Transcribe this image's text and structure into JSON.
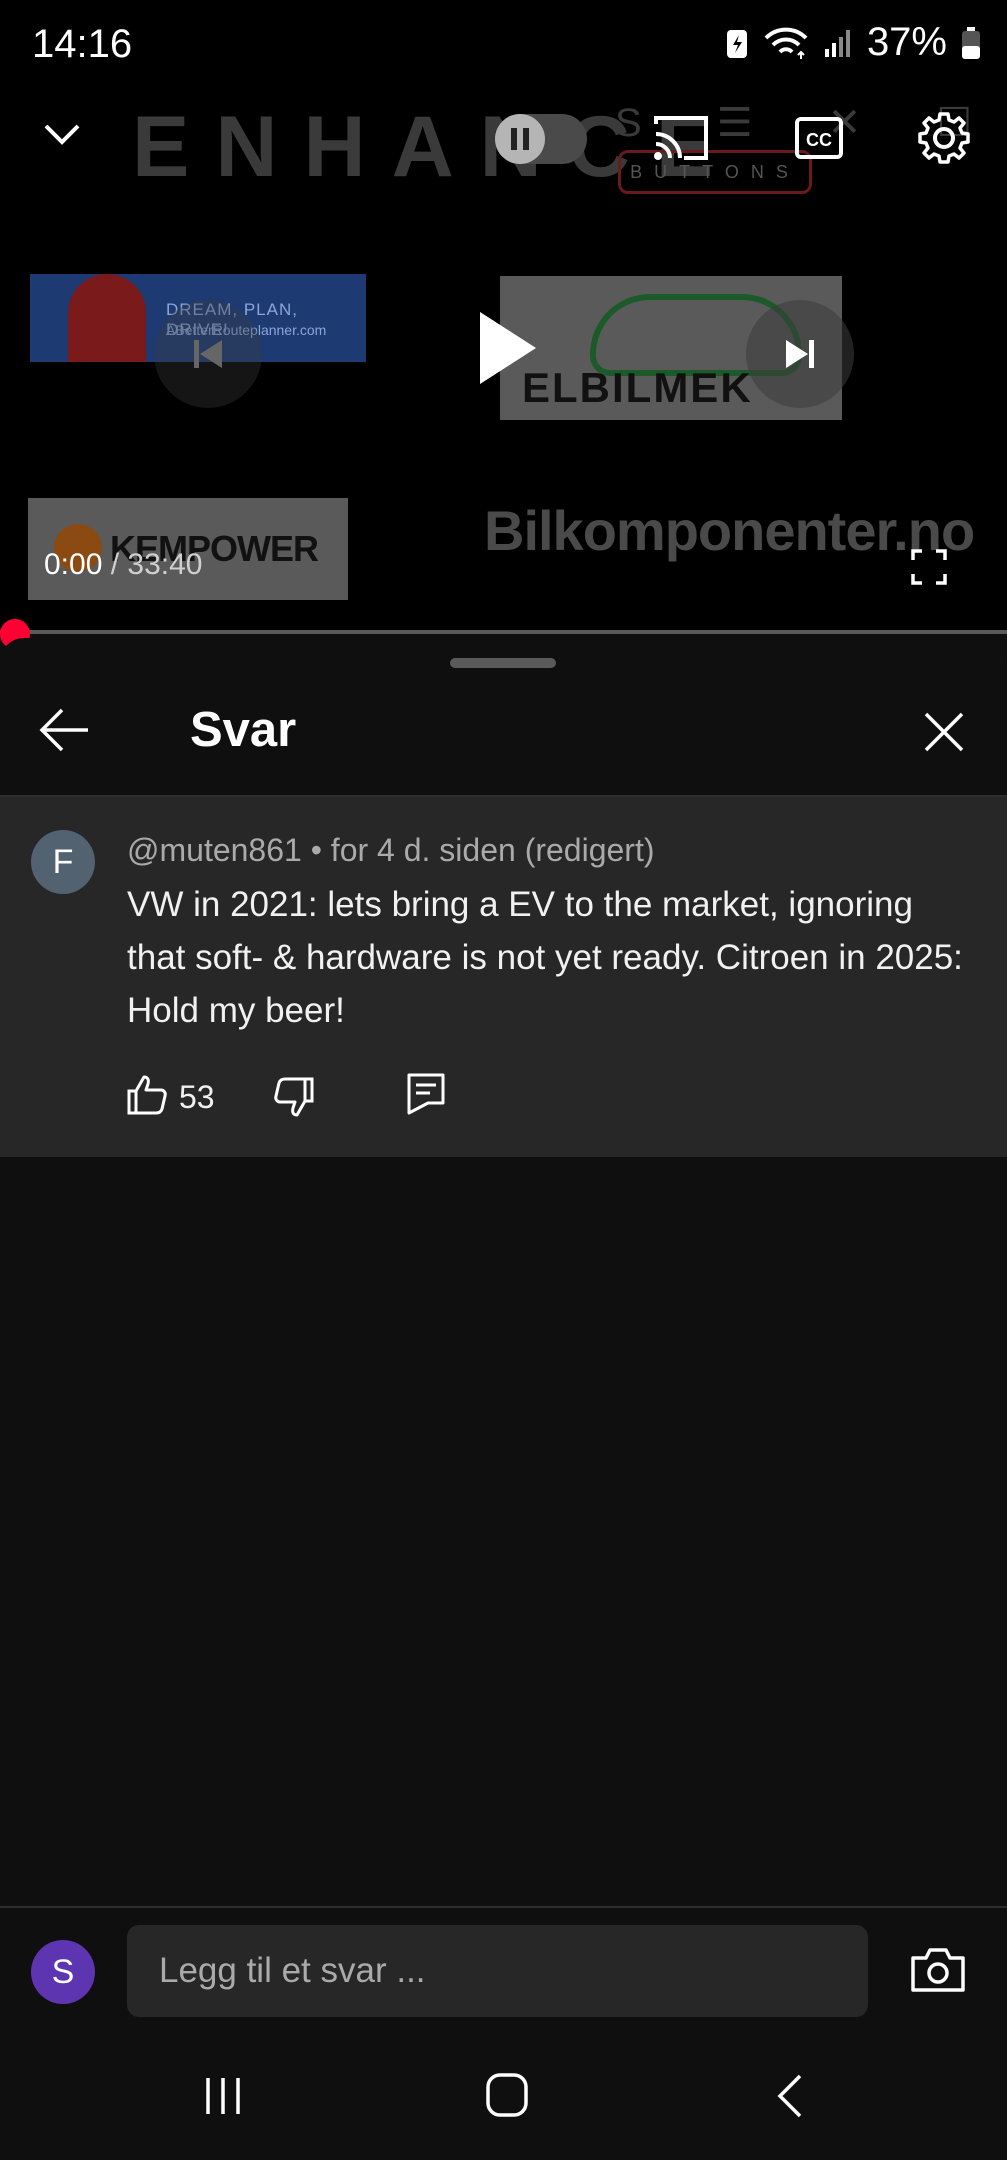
{
  "status_bar": {
    "time": "14:16",
    "battery_percent": "37%",
    "icons": [
      "battery-saver-icon",
      "wifi-icon",
      "signal-icon",
      "battery-icon"
    ]
  },
  "video": {
    "watermark_title": "ENHANCE",
    "watermark_buttons": "BUTTONS",
    "sponsors": {
      "abrp_tagline": "DREAM, PLAN, DRIVE!",
      "abrp_url": "ABetterRouteplanner.com",
      "elbilmek": "ELBILMEK",
      "kempower": "KEMPOWER",
      "bilkomponenter": "Bilkomponenter.no"
    },
    "current_time": "0:00",
    "separator": " / ",
    "duration": "33:40",
    "progress_fraction": 0,
    "icons": [
      "chevron-down-icon",
      "autoplay-toggle-icon",
      "cast-icon",
      "captions-icon",
      "settings-icon",
      "previous-icon",
      "play-icon",
      "next-icon",
      "fullscreen-icon"
    ]
  },
  "replies_panel": {
    "title": "Svar",
    "comment": {
      "avatar_letter": "F",
      "meta": "@muten861 • for 4 d. siden (redigert)",
      "text": "VW in 2021: lets bring a EV to the market, ignoring that soft- & hardware is not yet ready. Citroen in 2025: Hold my beer!",
      "like_count": "53"
    },
    "composer": {
      "avatar_letter": "S",
      "placeholder": "Legg til et svar ..."
    }
  },
  "colors": {
    "background": "#0f0f0f",
    "card": "#272727",
    "accent_red": "#ff0033",
    "avatar_f": "#526270",
    "avatar_s": "#5e35b1"
  }
}
